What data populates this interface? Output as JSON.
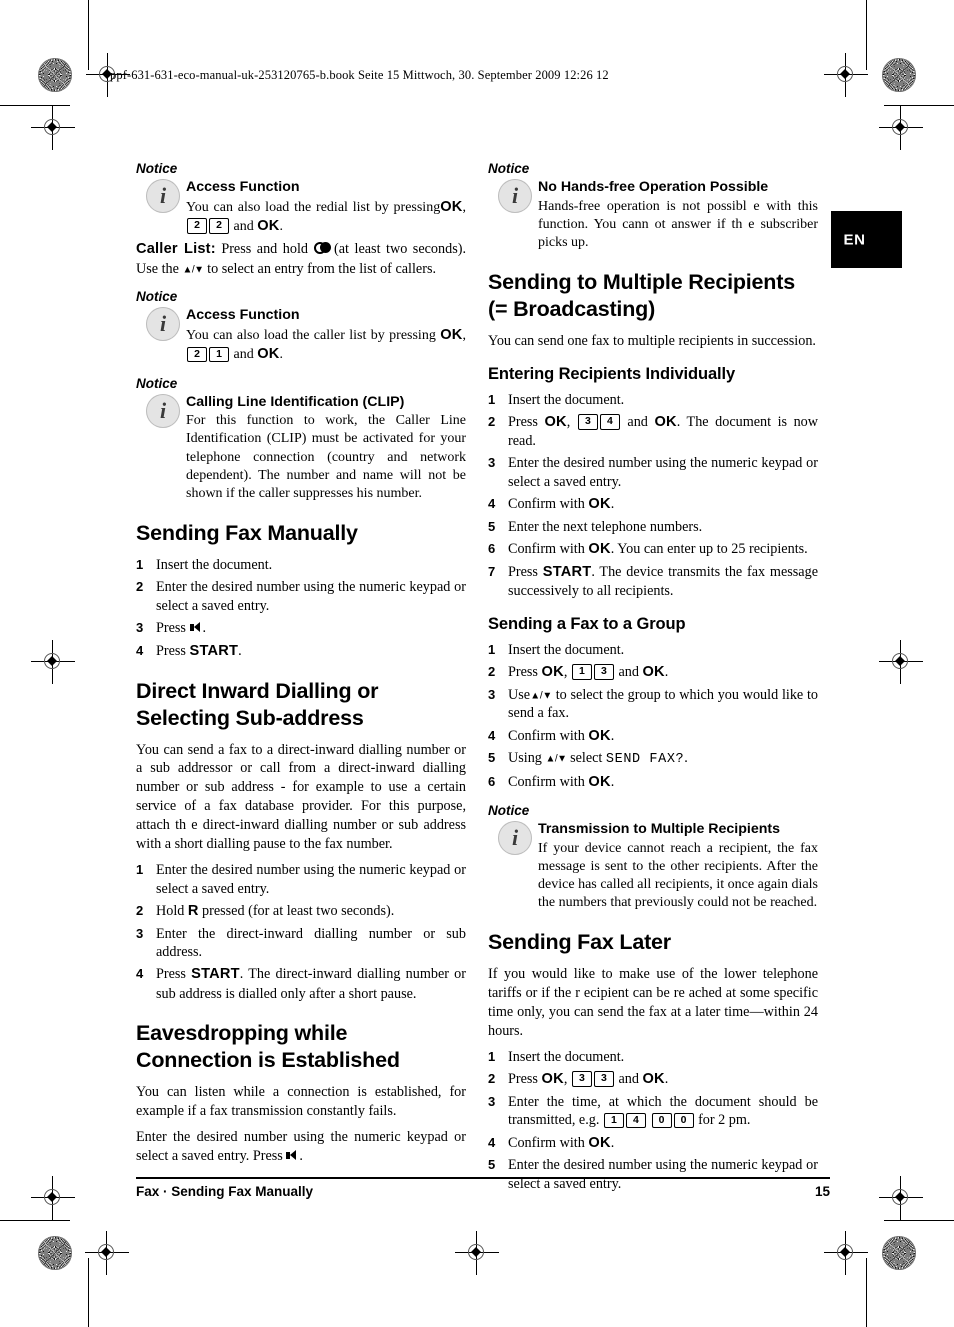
{
  "page": {
    "header_line": "ppf-631-631-eco-manual-uk-253120765-b.book  Seite 15  Mittwoch, 30. September 2009  12:26 12",
    "language_tab": "EN",
    "footer_left": "Fax  ·  Sending Fax Manually",
    "footer_page_number": "15",
    "notice_label": "Notice"
  },
  "left_column": {
    "notice_access_redial": {
      "label": "Notice",
      "title": "Access Function",
      "body_before": "You can also load the redial list by pressing",
      "ok1": "OK",
      "key1": "2",
      "key2": "2",
      "body_mid": "and",
      "ok2": "OK",
      "body_end": "."
    },
    "caller_list_para": {
      "lead": "Caller List:",
      "text_a": "Press and hold",
      "icon": "redial-icon",
      "text_b": "(at least two seconds). Use the",
      "arrows": "▲/▼",
      "text_c": "to select an entry from the list of callers."
    },
    "notice_access_caller": {
      "label": "Notice",
      "title": "Access Function",
      "body_before": "You can also load the caller list by pressing",
      "ok1": "OK",
      "key1": "2",
      "key2": "1",
      "body_mid": "and",
      "ok2": "OK",
      "body_end": "."
    },
    "notice_clip": {
      "label": "Notice",
      "title": "Calling Line Identification (CLIP)",
      "body": "For this function to work, the Caller Line Identification (CLIP) must be activated for your telephone connection (country and network dependent). The number and name will not be shown if the caller suppresses his number."
    },
    "sending_fax_manually": {
      "heading": "Sending Fax Manually",
      "steps": [
        {
          "num": "1",
          "text": "Insert the document."
        },
        {
          "num": "2",
          "text": "Enter the desired number using the numeric keypad or select a saved entry."
        },
        {
          "num": "3",
          "text": "Press",
          "icon": "speaker-icon",
          "tail": "."
        },
        {
          "num": "4",
          "text": "Press",
          "ui": "START",
          "tail": "."
        }
      ]
    },
    "direct_inward_dialling": {
      "heading": "Direct Inward Dialling or Selecting Sub-address",
      "intro": "You can send a fax to a direct-inward dialling number or a sub addressor or call from a direct-inward dialling number or sub address - for example to use a certain service of a fax database provider. For this purpose, attach th e direct-inward dialling number or sub address with a short dialling pause to the fax number.",
      "steps": [
        {
          "num": "1",
          "text": "Enter the desired number using the numeric keypad or select a saved entry."
        },
        {
          "num": "2",
          "text_a": "Hold",
          "ui": "R",
          "text_b": "pressed (for at least two seconds)."
        },
        {
          "num": "3",
          "text": "Enter the direct-inward dialling number or sub address."
        },
        {
          "num": "4",
          "text_a": "Press",
          "ui": "START",
          "text_b": ". The direct-inward dialling number or sub address is dialled only after a short pause."
        }
      ]
    },
    "eavesdropping": {
      "heading": "Eavesdropping while Connection is Established",
      "para1": "You can listen while a connection is established, for example if a fax transmission constantly fails.",
      "para2_a": "Enter the desired number using the numeric   keypad or select a saved entry. Press",
      "para2_icon": "speaker-icon",
      "para2_b": "."
    }
  },
  "right_column": {
    "notice_no_handsfree": {
      "label": "Notice",
      "title": "No Hands-free Operation Possible",
      "body": "Hands-free operation is not possibl e with this function. You cann ot answer if th e subscriber picks up."
    },
    "broadcasting": {
      "heading": "Sending to Multiple Recipients (= Broadcasting)",
      "intro": "You can send one fax to multiple recipients in succession."
    },
    "entering_recipients": {
      "heading": "Entering Recipients Individually",
      "steps": [
        {
          "num": "1",
          "text": "Insert the document."
        },
        {
          "num": "2",
          "text_a": "Press",
          "ok1": "OK",
          "comma": ",",
          "key1": "3",
          "key2": "4",
          "text_b": "and",
          "ok2": "OK",
          "text_c": ". The document is now read."
        },
        {
          "num": "3",
          "text": "Enter the desired number using the numeric keypad or select a saved entry."
        },
        {
          "num": "4",
          "text_a": "Confirm with",
          "ok1": "OK",
          "text_c": "."
        },
        {
          "num": "5",
          "text": "Enter the next telephone numbers."
        },
        {
          "num": "6",
          "text_a": "Confirm with",
          "ok1": "OK",
          "text_c": ". You can enter up to 25 recipients."
        },
        {
          "num": "7",
          "text_a": "Press",
          "ui": "START",
          "text_c": ". The device transmits the fax message successively to all recipients."
        }
      ]
    },
    "sending_to_group": {
      "heading": "Sending a Fax to a Group",
      "steps": [
        {
          "num": "1",
          "text": "Insert the document."
        },
        {
          "num": "2",
          "text_a": "Press",
          "ok1": "OK",
          "comma": ",",
          "key1": "1",
          "key2": "3",
          "text_b": "and",
          "ok2": "OK",
          "text_c": "."
        },
        {
          "num": "3",
          "text_a": "Use",
          "arrows": "▲/▼",
          "text_c": "to select the group to which you would like to send a fax."
        },
        {
          "num": "4",
          "text_a": "Confirm with",
          "ok1": "OK",
          "text_c": "."
        },
        {
          "num": "5",
          "text_a": "Using",
          "arrows": "▲/▼",
          "text_b": "select",
          "lcd": "SEND FAX?",
          "text_c": "."
        },
        {
          "num": "6",
          "text_a": "Confirm with",
          "ok1": "OK",
          "text_c": "."
        }
      ]
    },
    "notice_transmission": {
      "label": "Notice",
      "title": "Transmission to Multiple Recipients",
      "body": "If your device cannot reach a  recipient, the fax message is sent to the other recipients. After the device has called all recipients, it once again dials the  numbers that    previously could not be reached."
    },
    "sending_fax_later": {
      "heading": "Sending Fax Later",
      "intro": "If you would like to make use of the lower telephone tariffs or if the r ecipient can be re ached at some specific time only, you can send the fax at a later time—within 24 hours.",
      "steps": [
        {
          "num": "1",
          "text": "Insert the document."
        },
        {
          "num": "2",
          "text_a": "Press",
          "ok1": "OK",
          "comma": ",",
          "key1": "3",
          "key2": "3",
          "text_b": "and",
          "ok2": "OK",
          "text_c": "."
        },
        {
          "num": "3",
          "text_a": "Enter the time, at which the document should be transmitted, e.g.",
          "key1": "1",
          "key2": "4",
          "key3": "0",
          "key4": "0",
          "text_c": "for 2 pm."
        },
        {
          "num": "4",
          "text_a": "Confirm with",
          "ok1": "OK",
          "text_c": "."
        },
        {
          "num": "5",
          "text": "Enter the desired number using the numeric keypad or select a saved entry."
        }
      ]
    }
  }
}
